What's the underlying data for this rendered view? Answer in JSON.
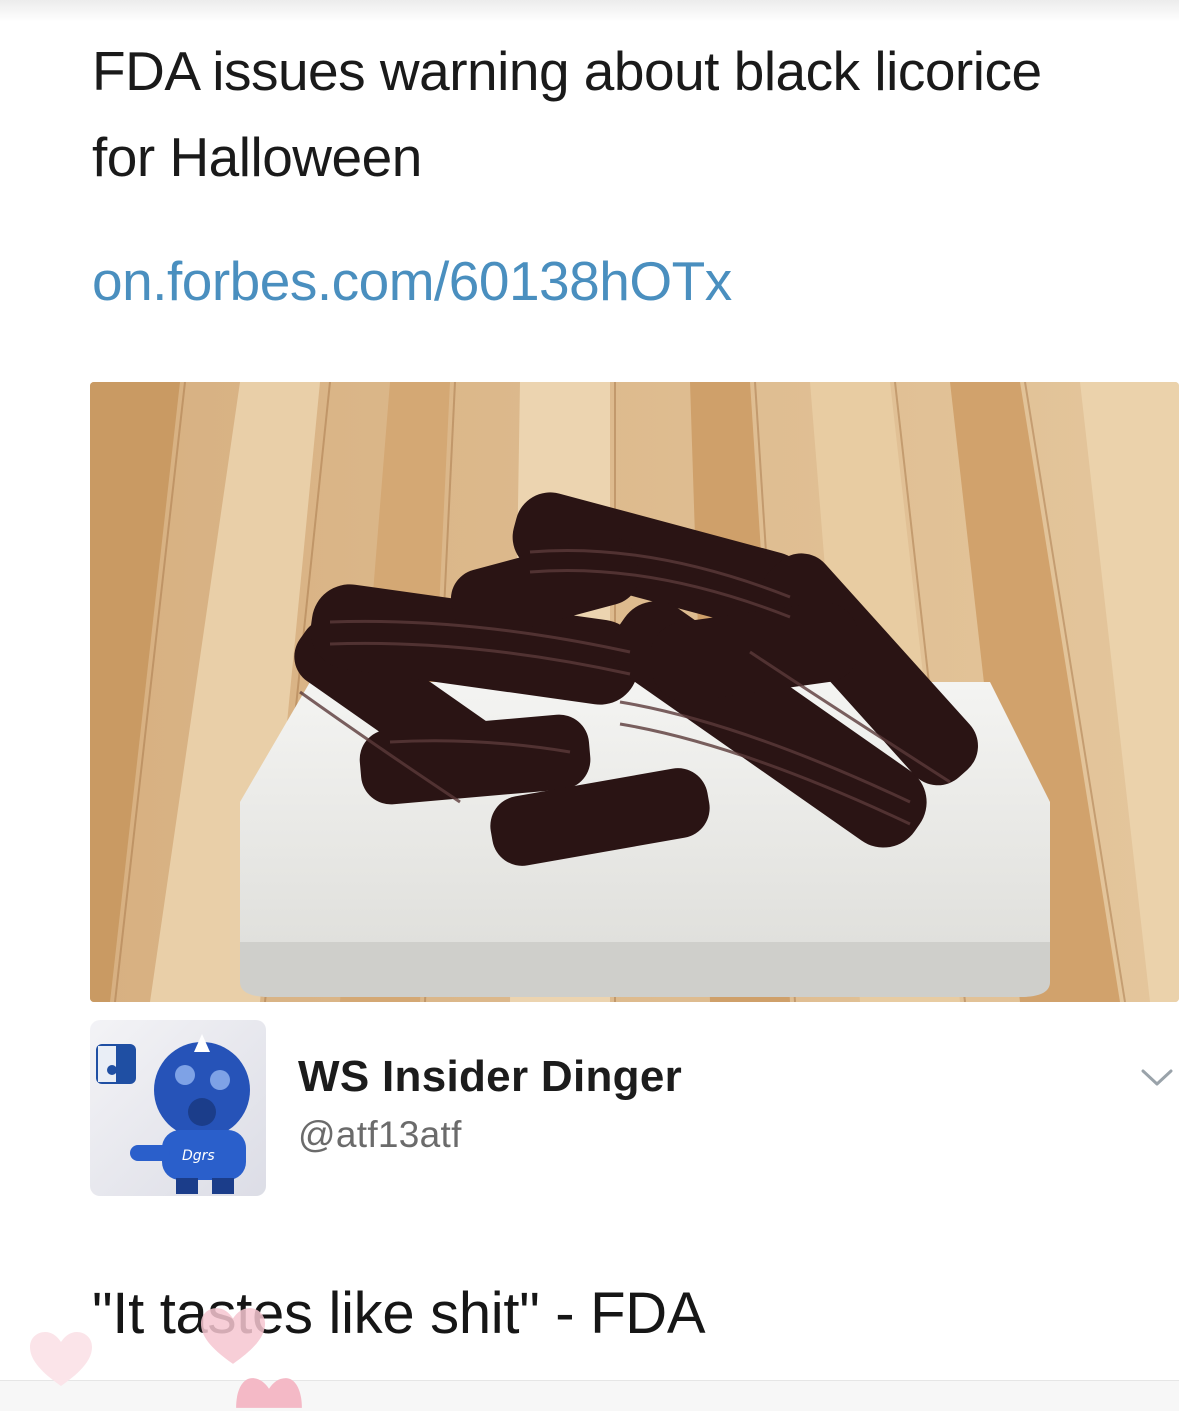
{
  "tweet": {
    "text": "FDA issues warning about black licorice for Halloween",
    "link": "on.forbes.com/60138hOTx",
    "link_color": "#4a8fbf"
  },
  "media": {
    "image_alt_icon": "licorice-photo"
  },
  "quoted_author": {
    "name": "WS Insider Dinger",
    "handle": "@atf13atf",
    "avatar_icon": "mascot-avatar",
    "menu_icon": "chevron-down-icon"
  },
  "caption": "\"It tastes like shit\" - FDA",
  "colors": {
    "heart": "#f6c6d0",
    "link": "#4a8fbf"
  }
}
